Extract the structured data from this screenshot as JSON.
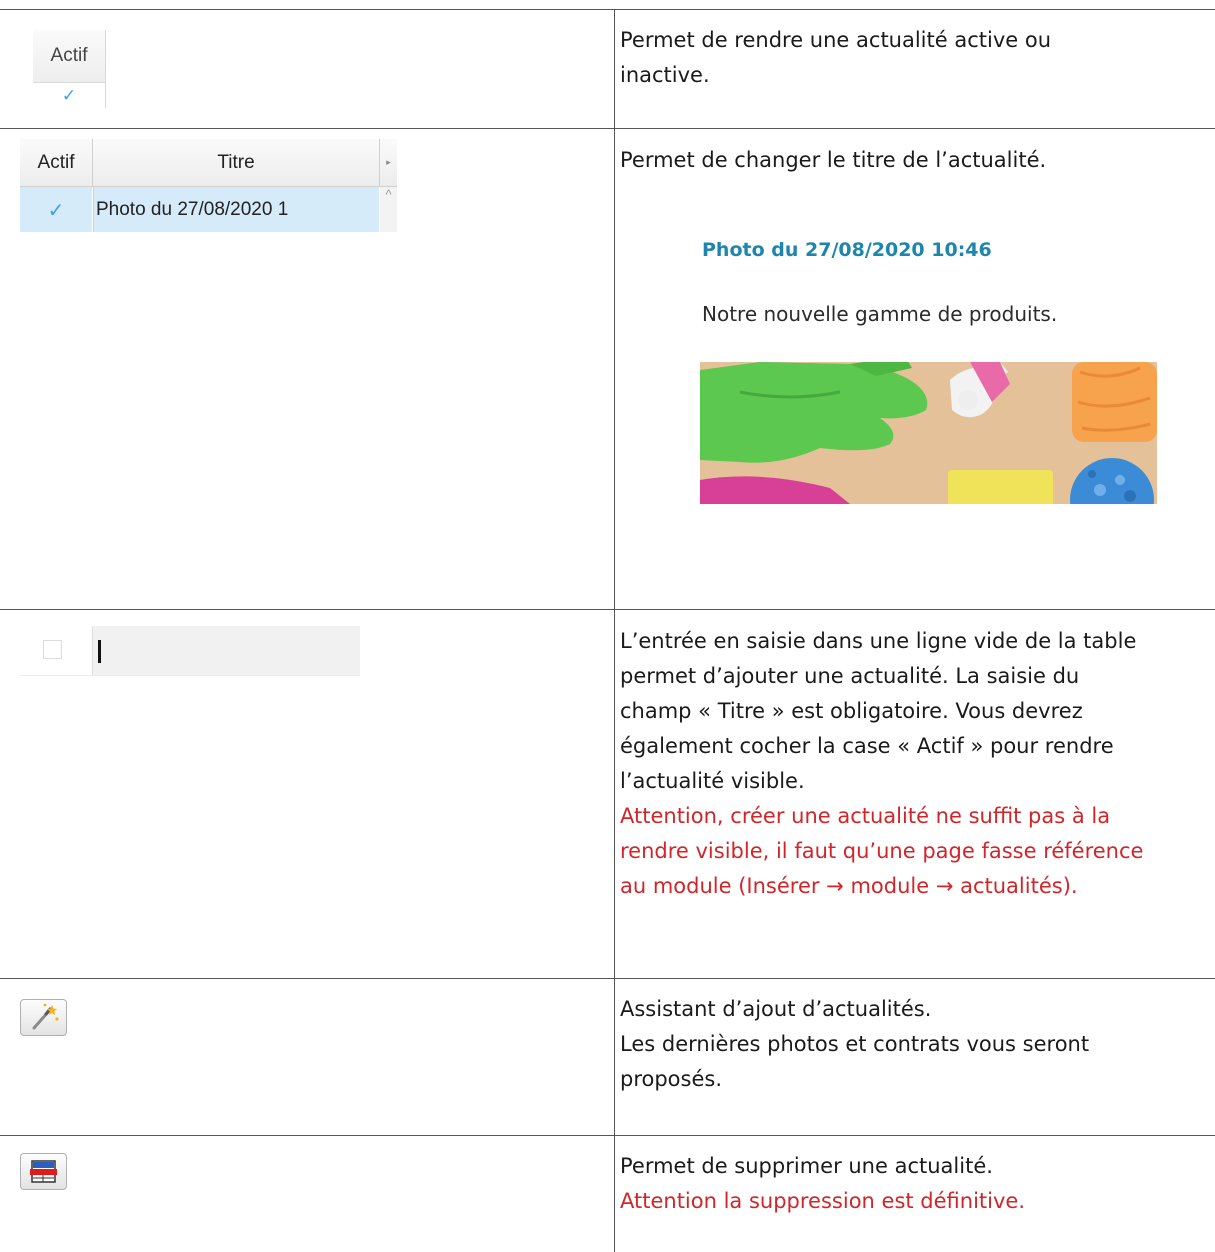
{
  "rows": [
    {
      "left": {
        "header": "Actif",
        "check": "✓"
      },
      "right": {
        "lines": [
          "Permet de rendre une actualité active ou",
          "inactive."
        ]
      }
    },
    {
      "left": {
        "grid": {
          "col_actif": "Actif",
          "col_titre": "Titre",
          "arrow": "▸",
          "row_check": "✓",
          "row_titre": "Photo du 27/08/2020 1",
          "scroll_icon": "^"
        }
      },
      "right": {
        "lines": [
          "Permet de changer le titre de l’actualité."
        ],
        "preview": {
          "title": "Photo du 27/08/2020 10:46",
          "text": "Notre nouvelle gamme de produits."
        }
      }
    },
    {
      "left": {
        "input_value": ""
      },
      "right": {
        "lines": [
          "L’entrée en saisie dans une ligne vide de la table",
          "permet d’ajouter une actualité. La saisie du",
          "champ « Titre » est obligatoire. Vous devrez",
          "également cocher la case « Actif » pour rendre",
          "l’actualité visible."
        ],
        "warning_lines": [
          "Attention, créer une actualité ne suffit pas à la",
          "rendre visible, il faut qu’une page fasse référence",
          "au module (Insérer → module → actualités)."
        ]
      }
    },
    {
      "left": {
        "icon": "magic-wand-icon"
      },
      "right": {
        "lines": [
          "Assistant d’ajout d’actualités.",
          "Les dernières photos et contrats vous seront",
          "proposés."
        ]
      }
    },
    {
      "left": {
        "icon": "delete-row-icon"
      },
      "right": {
        "lines": [
          "Permet de supprimer une actualité."
        ],
        "warning_lines": [
          "Attention la suppression est définitive."
        ]
      }
    }
  ],
  "colors": {
    "warning": "#d0262a",
    "preview_title": "#1e86ad",
    "selection": "#d6ebfa",
    "check": "#3aa2e6"
  }
}
